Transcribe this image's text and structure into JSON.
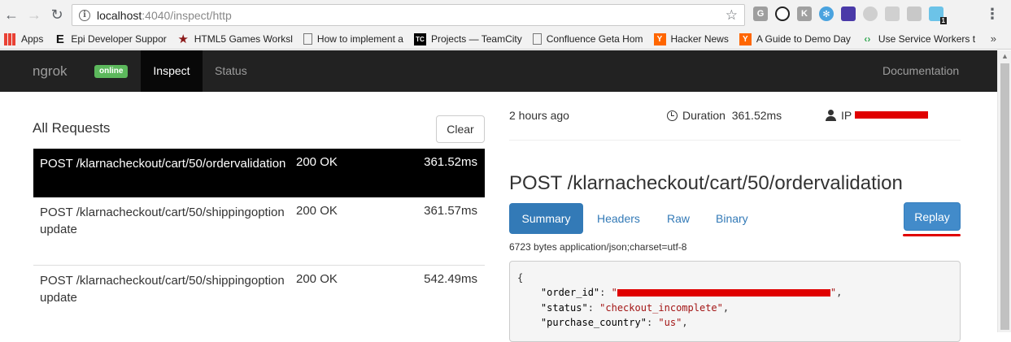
{
  "browser": {
    "url_host": "localhost",
    "url_rest": ":4040/inspect/http",
    "extensions": [
      "G",
      "K",
      "1"
    ],
    "bookmarks": [
      {
        "label": "Apps"
      },
      {
        "label": "Epi Developer Suppor"
      },
      {
        "label": "HTML5 Games Worksl"
      },
      {
        "label": "How to implement a"
      },
      {
        "label": "Projects — TeamCity"
      },
      {
        "label": "Confluence Geta Hom"
      },
      {
        "label": "Hacker News"
      },
      {
        "label": "A Guide to Demo Day"
      },
      {
        "label": "Use Service Workers t"
      }
    ],
    "more_bookmarks": "»"
  },
  "nav": {
    "brand": "ngrok",
    "badge": "online",
    "inspect": "Inspect",
    "status": "Status",
    "documentation": "Documentation"
  },
  "requests": {
    "heading": "All Requests",
    "clear_label": "Clear",
    "rows": [
      {
        "method": "POST",
        "path": "POST /klarnacheckout/cart/50/ordervalidation",
        "status": "200 OK",
        "duration": "361.52ms"
      },
      {
        "path": "POST /klarnacheckout/cart/50/shippingoptionupdate",
        "status": "200 OK",
        "duration": "361.57ms"
      },
      {
        "path": "POST /klarnacheckout/cart/50/shippingoptionupdate",
        "status": "200 OK",
        "duration": "542.49ms"
      }
    ]
  },
  "detail": {
    "time_ago": "2 hours ago",
    "duration_label": "Duration",
    "duration_value": "361.52ms",
    "ip_label": "IP",
    "title": "POST /klarnacheckout/cart/50/ordervalidation",
    "tabs": {
      "summary": "Summary",
      "headers": "Headers",
      "raw": "Raw",
      "binary": "Binary"
    },
    "replay_label": "Replay",
    "bytes_info": "6723 bytes application/json;charset=utf-8",
    "json_lines": {
      "open": "{",
      "order_id_key": "\"order_id\"",
      "status_key": "\"status\"",
      "status_val": "\"checkout_incomplete\"",
      "country_key": "\"purchase_country\"",
      "country_val": "\"us\""
    }
  },
  "colors": {
    "navbar": "#222222",
    "badge": "#5cb85c",
    "primary": "#337ab7",
    "redaction": "#e00000"
  }
}
